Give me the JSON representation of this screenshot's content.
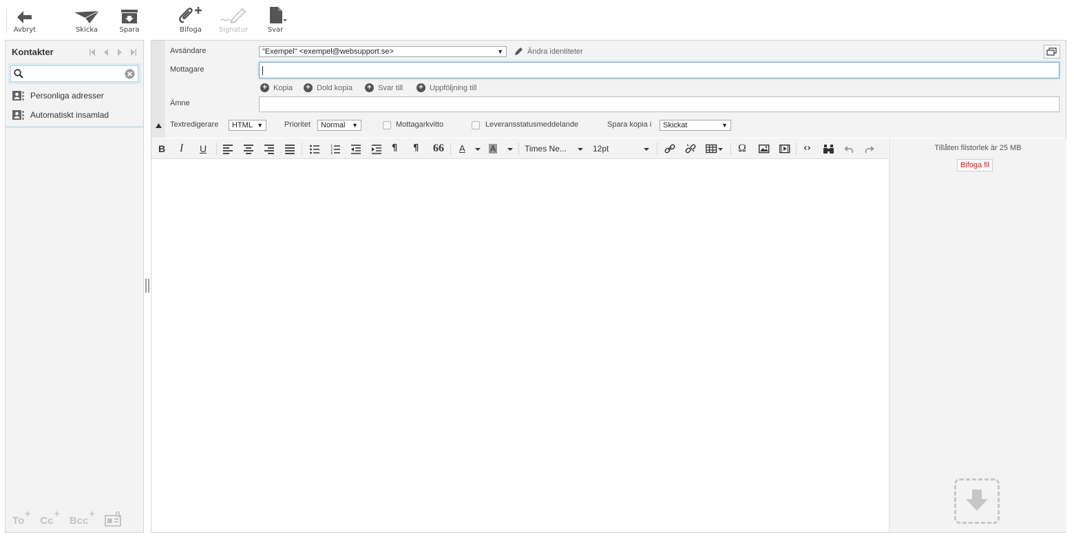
{
  "toolbar": {
    "cancel": "Avbryt",
    "send": "Skicka",
    "save": "Spara",
    "attach": "Bifoga",
    "signature": "Signatur",
    "reply": "Svar"
  },
  "contacts": {
    "title": "Kontakter",
    "search_value": "",
    "items": [
      {
        "label": "Personliga adresser",
        "icon": "address-book-icon"
      },
      {
        "label": "Automatiskt insamlad",
        "icon": "address-book-icon"
      }
    ],
    "recipient_buttons": {
      "to": "To",
      "cc": "Cc",
      "bcc": "Bcc"
    }
  },
  "compose": {
    "sender_label": "Avsändare",
    "sender_value": "\"Exempel\" <exempel@websupport.se>",
    "edit_identities": "Ändra identiteter",
    "recipient_label": "Mottagare",
    "recipient_value": "",
    "add_cc": "Kopia",
    "add_bcc": "Dold kopia",
    "add_replyto": "Svar till",
    "add_followupto": "Uppföljning till",
    "subject_label": "Ämne",
    "subject_value": "",
    "editor_type_label": "Textredigerare",
    "editor_type_value": "HTML",
    "priority_label": "Prioritet",
    "priority_value": "Normal",
    "receipt_label": "Mottagarkvitto",
    "dsn_label": "Leveransstatusmeddelande",
    "store_label": "Spara kopia i",
    "store_value": "Skickat"
  },
  "editor": {
    "font_family": "Times Ne...",
    "font_size": "12pt"
  },
  "attachments": {
    "max_size_info": "Tillåten filstorlek är 25 MB",
    "attach_file_button": "Bifoga fil"
  },
  "colors": {
    "panel_bg": "#f3f3f3",
    "focus_border": "#6ea6c9",
    "attach_button_text": "#dd1111"
  }
}
